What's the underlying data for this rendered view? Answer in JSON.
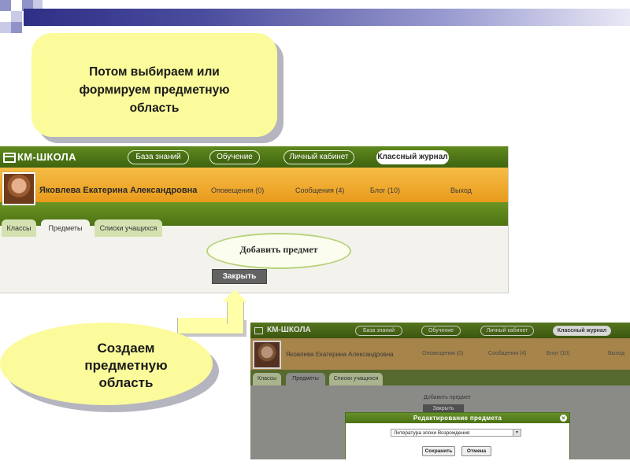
{
  "callouts": {
    "top_text": "Потом выбираем или формируем предметную область",
    "bottom_text": "Создаем предметную область"
  },
  "app": {
    "logo": "КМ-ШКОЛА",
    "nav": [
      "База знаний",
      "Обучение",
      "Личный кабинет",
      "Классный журнал"
    ],
    "active_nav": "Классный журнал",
    "user_name": "Яковлева Екатерина Александровна",
    "user_links": [
      "Оповещения (0)",
      "Сообщения (4)",
      "Блог (10)",
      "Выход"
    ],
    "tabs": [
      "Классы",
      "Предметы",
      "Списки учащихся"
    ],
    "active_tab": "Предметы",
    "add_subject_label": "Добавить предмет",
    "close_button": "Закрыть"
  },
  "dialog": {
    "title": "Редактирование предмета",
    "close_symbol": "×",
    "selected_subject": "Литература эпохи Возрождения",
    "save_button": "Сохранить",
    "cancel_button": "Отмена"
  },
  "colors": {
    "accent_green": "#4c7214",
    "user_bar_orange": "#f0a82e",
    "callout_yellow": "#fbfb9c"
  },
  "icons": [
    "window-icon",
    "dropdown-arrow-icon",
    "close-icon"
  ]
}
